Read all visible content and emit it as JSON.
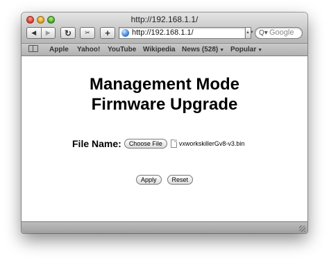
{
  "window": {
    "title": "http://192.168.1.1/"
  },
  "toolbar": {
    "back_icon": "◀",
    "forward_icon": "▶",
    "reload_icon": "↻",
    "snapshot_icon": "✂",
    "add_bookmark_icon": "+",
    "url": "http://192.168.1.1/",
    "search_placeholder": "Google",
    "search_icon": "Q▾"
  },
  "bookmarks": {
    "items": [
      "Apple",
      "Yahoo!",
      "YouTube",
      "Wikipedia",
      "News (528)",
      "Popular"
    ]
  },
  "page": {
    "heading_line1": "Management Mode",
    "heading_line2": "Firmware Upgrade",
    "file_label": "File Name:",
    "choose_file_button": "Choose File",
    "chosen_file": "vxworkskillerGv8-v3.bin",
    "apply_button": "Apply",
    "reset_button": "Reset"
  }
}
